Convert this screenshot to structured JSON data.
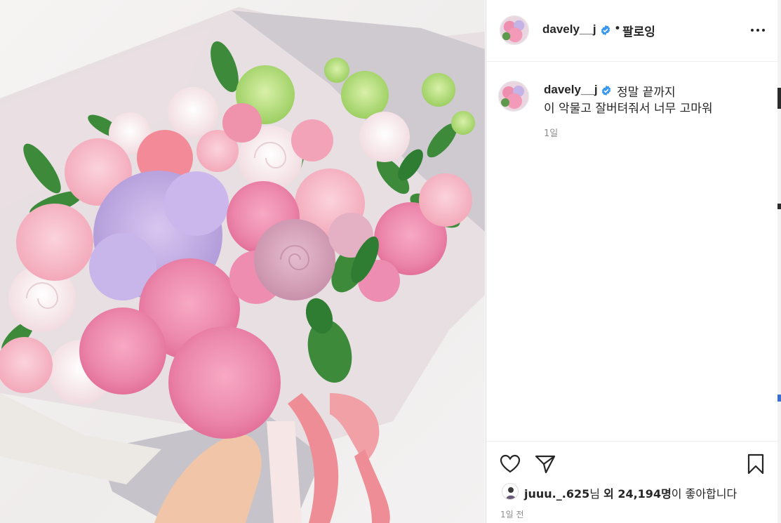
{
  "post": {
    "username": "davely__j",
    "follow_label": "팔로잉",
    "separator": "•",
    "caption_line1": "정말 끝까지",
    "caption_line2": "이 악물고 잘버텨줘서 너무 고마워",
    "caption_age": "1일",
    "liked_by_user": "juuu._.625",
    "liked_by_suffix": "님 ",
    "likes_prefix": "외 ",
    "likes_count": "24,194명",
    "likes_suffix": "이 좋아합니다",
    "posted_time": "1일 전"
  },
  "icons": {
    "verified": "verified-badge-icon",
    "more": "more-options-icon",
    "like": "heart-icon",
    "share": "paper-plane-icon",
    "save": "bookmark-icon"
  },
  "colors": {
    "verified_blue": "#3897f0",
    "text": "#262626",
    "muted": "#8e8e8e",
    "border": "#dbdbdb"
  }
}
